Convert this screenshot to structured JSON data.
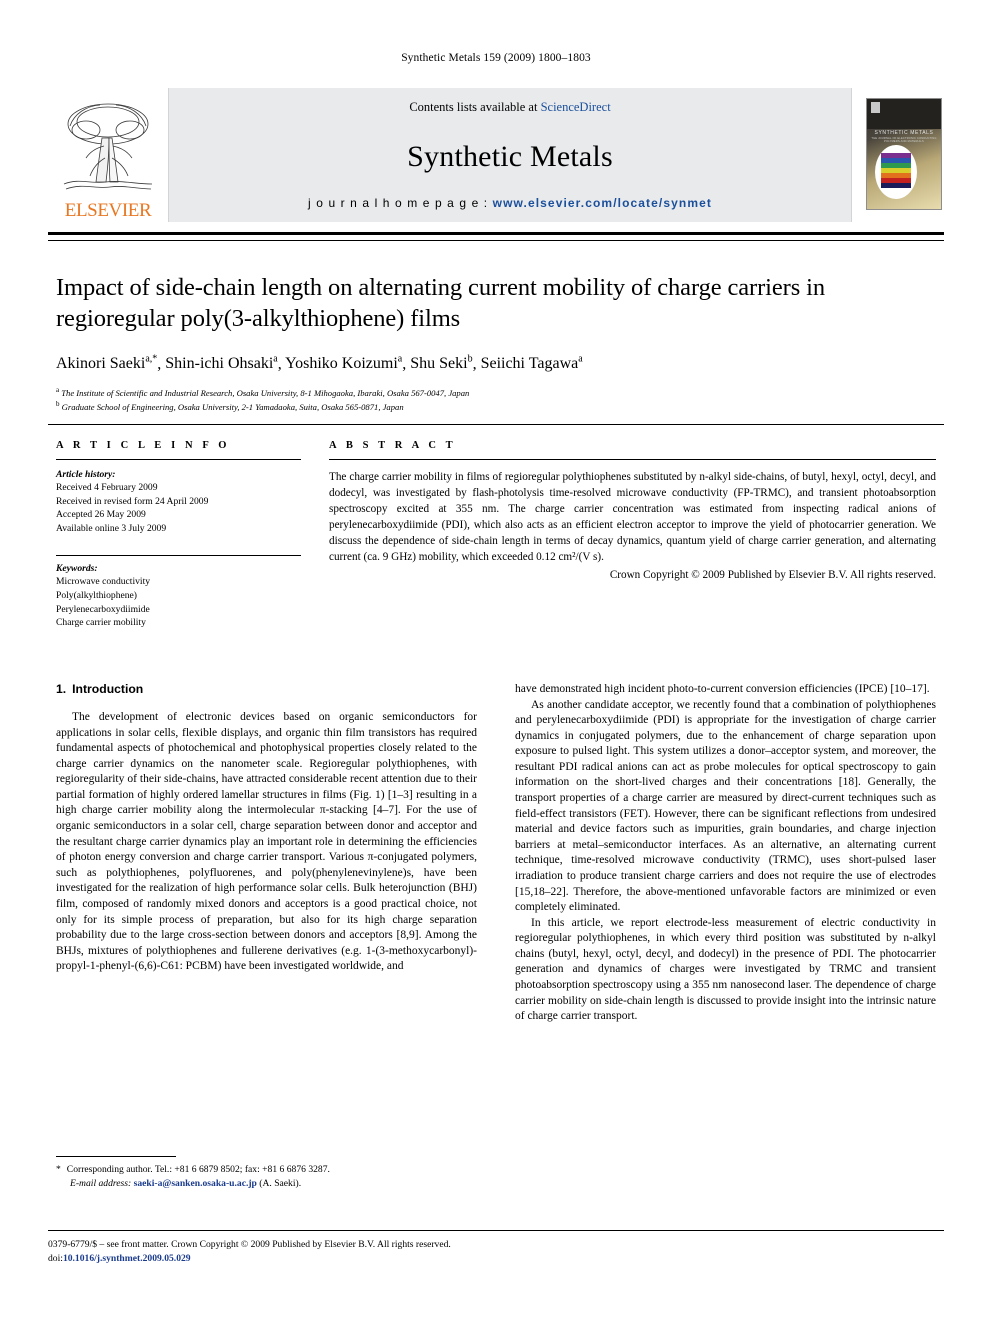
{
  "running_head": "Synthetic Metals 159 (2009) 1800–1803",
  "masthead": {
    "contents_prefix": "Contents lists available at ",
    "sciencedirect": "ScienceDirect",
    "journal_name": "Synthetic Metals",
    "homepage_prefix": "j o u r n a l   h o m e p a g e :  ",
    "homepage_url": "www.elsevier.com/locate/synmet",
    "publisher": "ELSEVIER",
    "cover_title": "SYNTHETIC METALS",
    "cover_subtitle": "THE JOURNAL OF ELECTRONIC CONDUCTING POLYMERS AND MATERIALS"
  },
  "article": {
    "title": "Impact of side-chain length on alternating current mobility of charge carriers in regioregular poly(3-alkylthiophene) films",
    "authors": [
      {
        "name": "Akinori Saeki",
        "sup": "a,*"
      },
      {
        "name": "Shin-ichi Ohsaki",
        "sup": "a"
      },
      {
        "name": "Yoshiko Koizumi",
        "sup": "a"
      },
      {
        "name": "Shu Seki",
        "sup": "b"
      },
      {
        "name": "Seiichi Tagawa",
        "sup": "a"
      }
    ],
    "affiliations": [
      {
        "sup": "a",
        "text": "The Institute of Scientific and Industrial Research, Osaka University, 8-1 Mihogaoka, Ibaraki, Osaka 567-0047, Japan"
      },
      {
        "sup": "b",
        "text": "Graduate School of Engineering, Osaka University, 2-1 Yamadaoka, Suita, Osaka 565-0871, Japan"
      }
    ]
  },
  "article_info": {
    "label": "A R T I C L E  I N F O",
    "history_heading": "Article history:",
    "history": [
      "Received 4 February 2009",
      "Received in revised form 24 April 2009",
      "Accepted 26 May 2009",
      "Available online 3 July 2009"
    ],
    "keywords_heading": "Keywords:",
    "keywords": [
      "Microwave conductivity",
      "Poly(alkylthiophene)",
      "Perylenecarboxydiimide",
      "Charge carrier mobility"
    ]
  },
  "abstract": {
    "label": "A B S T R A C T",
    "text": "The charge carrier mobility in films of regioregular polythiophenes substituted by n-alkyl side-chains, of butyl, hexyl, octyl, decyl, and dodecyl, was investigated by flash-photolysis time-resolved microwave conductivity (FP-TRMC), and transient photoabsorption spectroscopy excited at 355 nm. The charge carrier concentration was estimated from inspecting radical anions of perylenecarboxydiimide (PDI), which also acts as an efficient electron acceptor to improve the yield of photocarrier generation. We discuss the dependence of side-chain length in terms of decay dynamics, quantum yield of charge carrier generation, and alternating current (ca. 9 GHz) mobility, which exceeded 0.12 cm²/(V s).",
    "copyright": "Crown Copyright © 2009 Published by Elsevier B.V. All rights reserved."
  },
  "body": {
    "section_number": "1.",
    "section_title": "Introduction",
    "left_paragraphs": [
      "The development of electronic devices based on organic semiconductors for applications in solar cells, flexible displays, and organic thin film transistors has required fundamental aspects of photochemical and photophysical properties closely related to the charge carrier dynamics on the nanometer scale. Regioregular polythiophenes, with regioregularity of their side-chains, have attracted considerable recent attention due to their partial formation of highly ordered lamellar structures in films (Fig. 1) [1–3] resulting in a high charge carrier mobility along the intermolecular π-stacking [4–7]. For the use of organic semiconductors in a solar cell, charge separation between donor and acceptor and the resultant charge carrier dynamics play an important role in determining the efficiencies of photon energy conversion and charge carrier transport. Various π-conjugated polymers, such as polythiophenes, polyfluorenes, and poly(phenylenevinylene)s, have been investigated for the realization of high performance solar cells. Bulk heterojunction (BHJ) film, composed of randomly mixed donors and acceptors is a good practical choice, not only for its simple process of preparation, but also for its high charge separation probability due to the large cross-section between donors and acceptors [8,9]. Among the BHJs, mixtures of polythiophenes and fullerene derivatives (e.g. 1-(3-methoxycarbonyl)-propyl-1-phenyl-(6,6)-C61: PCBM) have been investigated worldwide, and"
    ],
    "right_paragraphs": [
      "have demonstrated high incident photo-to-current conversion efficiencies (IPCE) [10–17].",
      "As another candidate acceptor, we recently found that a combination of polythiophenes and perylenecarboxydiimide (PDI) is appropriate for the investigation of charge carrier dynamics in conjugated polymers, due to the enhancement of charge separation upon exposure to pulsed light. This system utilizes a donor–acceptor system, and moreover, the resultant PDI radical anions can act as probe molecules for optical spectroscopy to gain information on the short-lived charges and their concentrations [18]. Generally, the transport properties of a charge carrier are measured by direct-current techniques such as field-effect transistors (FET). However, there can be significant reflections from undesired material and device factors such as impurities, grain boundaries, and charge injection barriers at metal–semiconductor interfaces. As an alternative, an alternating current technique, time-resolved microwave conductivity (TRMC), uses short-pulsed laser irradiation to produce transient charge carriers and does not require the use of electrodes [15,18–22]. Therefore, the above-mentioned unfavorable factors are minimized or even completely eliminated.",
      "In this article, we report electrode-less measurement of electric conductivity in regioregular polythiophenes, in which every third position was substituted by n-alkyl chains (butyl, hexyl, octyl, decyl, and dodecyl) in the presence of PDI. The photocarrier generation and dynamics of charges were investigated by TRMC and transient photoabsorption spectroscopy using a 355 nm nanosecond laser. The dependence of charge carrier mobility on side-chain length is discussed to provide insight into the intrinsic nature of charge carrier transport."
    ]
  },
  "footnote": {
    "star": "*",
    "corresponding": "Corresponding author. Tel.: +81 6 6879 8502; fax: +81 6 6876 3287.",
    "email_label": "E-mail address:",
    "email": "saeki-a@sanken.osaka-u.ac.jp",
    "email_suffix": " (A. Saeki)."
  },
  "imprint": {
    "line1": "0379-6779/$ – see front matter. Crown Copyright © 2009 Published by Elsevier B.V. All rights reserved.",
    "doi_label": "doi:",
    "doi": "10.1016/j.synthmet.2009.05.029"
  },
  "colors": {
    "link": "#1a3b8c",
    "sciencedirect": "#1a4f9c",
    "elsevier_orange": "#E87722",
    "masthead_bg": "#e9eaec"
  }
}
